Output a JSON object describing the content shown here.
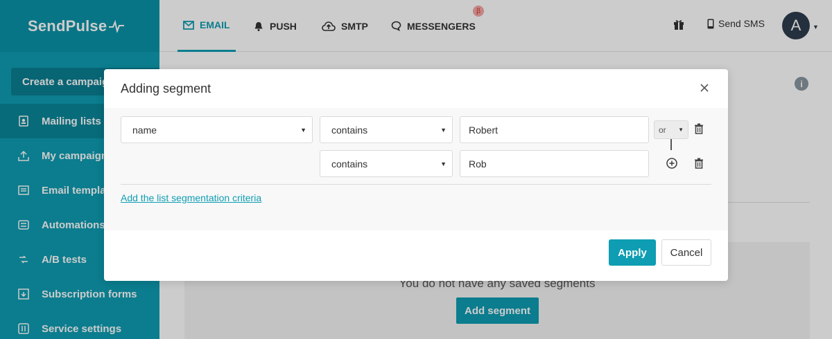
{
  "app": {
    "logo_text": "SendPulse",
    "brand_color": "#0e9db2"
  },
  "topnav": {
    "tabs": [
      {
        "label": "EMAIL",
        "icon": "envelope-icon",
        "active": true
      },
      {
        "label": "PUSH",
        "icon": "bell-icon",
        "active": false
      },
      {
        "label": "SMTP",
        "icon": "cloud-upload-icon",
        "active": false
      },
      {
        "label": "MESSENGERS",
        "icon": "chat-bubble-icon",
        "active": false
      }
    ],
    "beta_badge": "β",
    "send_sms_label": "Send SMS",
    "avatar_letter": "A"
  },
  "sidebar": {
    "create_button": "Create a campaign",
    "items": [
      {
        "label": "Mailing lists",
        "icon": "contacts-icon",
        "active": true
      },
      {
        "label": "My campaigns",
        "icon": "upload-tray-icon",
        "active": false
      },
      {
        "label": "Email templates",
        "icon": "template-icon",
        "active": false
      },
      {
        "label": "Automations",
        "icon": "automation-icon",
        "active": false
      },
      {
        "label": "A/B tests",
        "icon": "ab-test-icon",
        "active": false
      },
      {
        "label": "Subscription forms",
        "icon": "form-icon",
        "active": false
      },
      {
        "label": "Service settings",
        "icon": "sliders-icon",
        "active": false
      }
    ]
  },
  "background": {
    "empty_text": "You do not have any saved segments",
    "add_segment_button": "Add segment"
  },
  "modal": {
    "title": "Adding segment",
    "rows": [
      {
        "field": "name",
        "operator": "contains",
        "value": "Robert",
        "connector": "or"
      },
      {
        "operator": "contains",
        "value": "Rob"
      }
    ],
    "add_criteria_link": "Add the list segmentation criteria",
    "apply_label": "Apply",
    "cancel_label": "Cancel"
  }
}
